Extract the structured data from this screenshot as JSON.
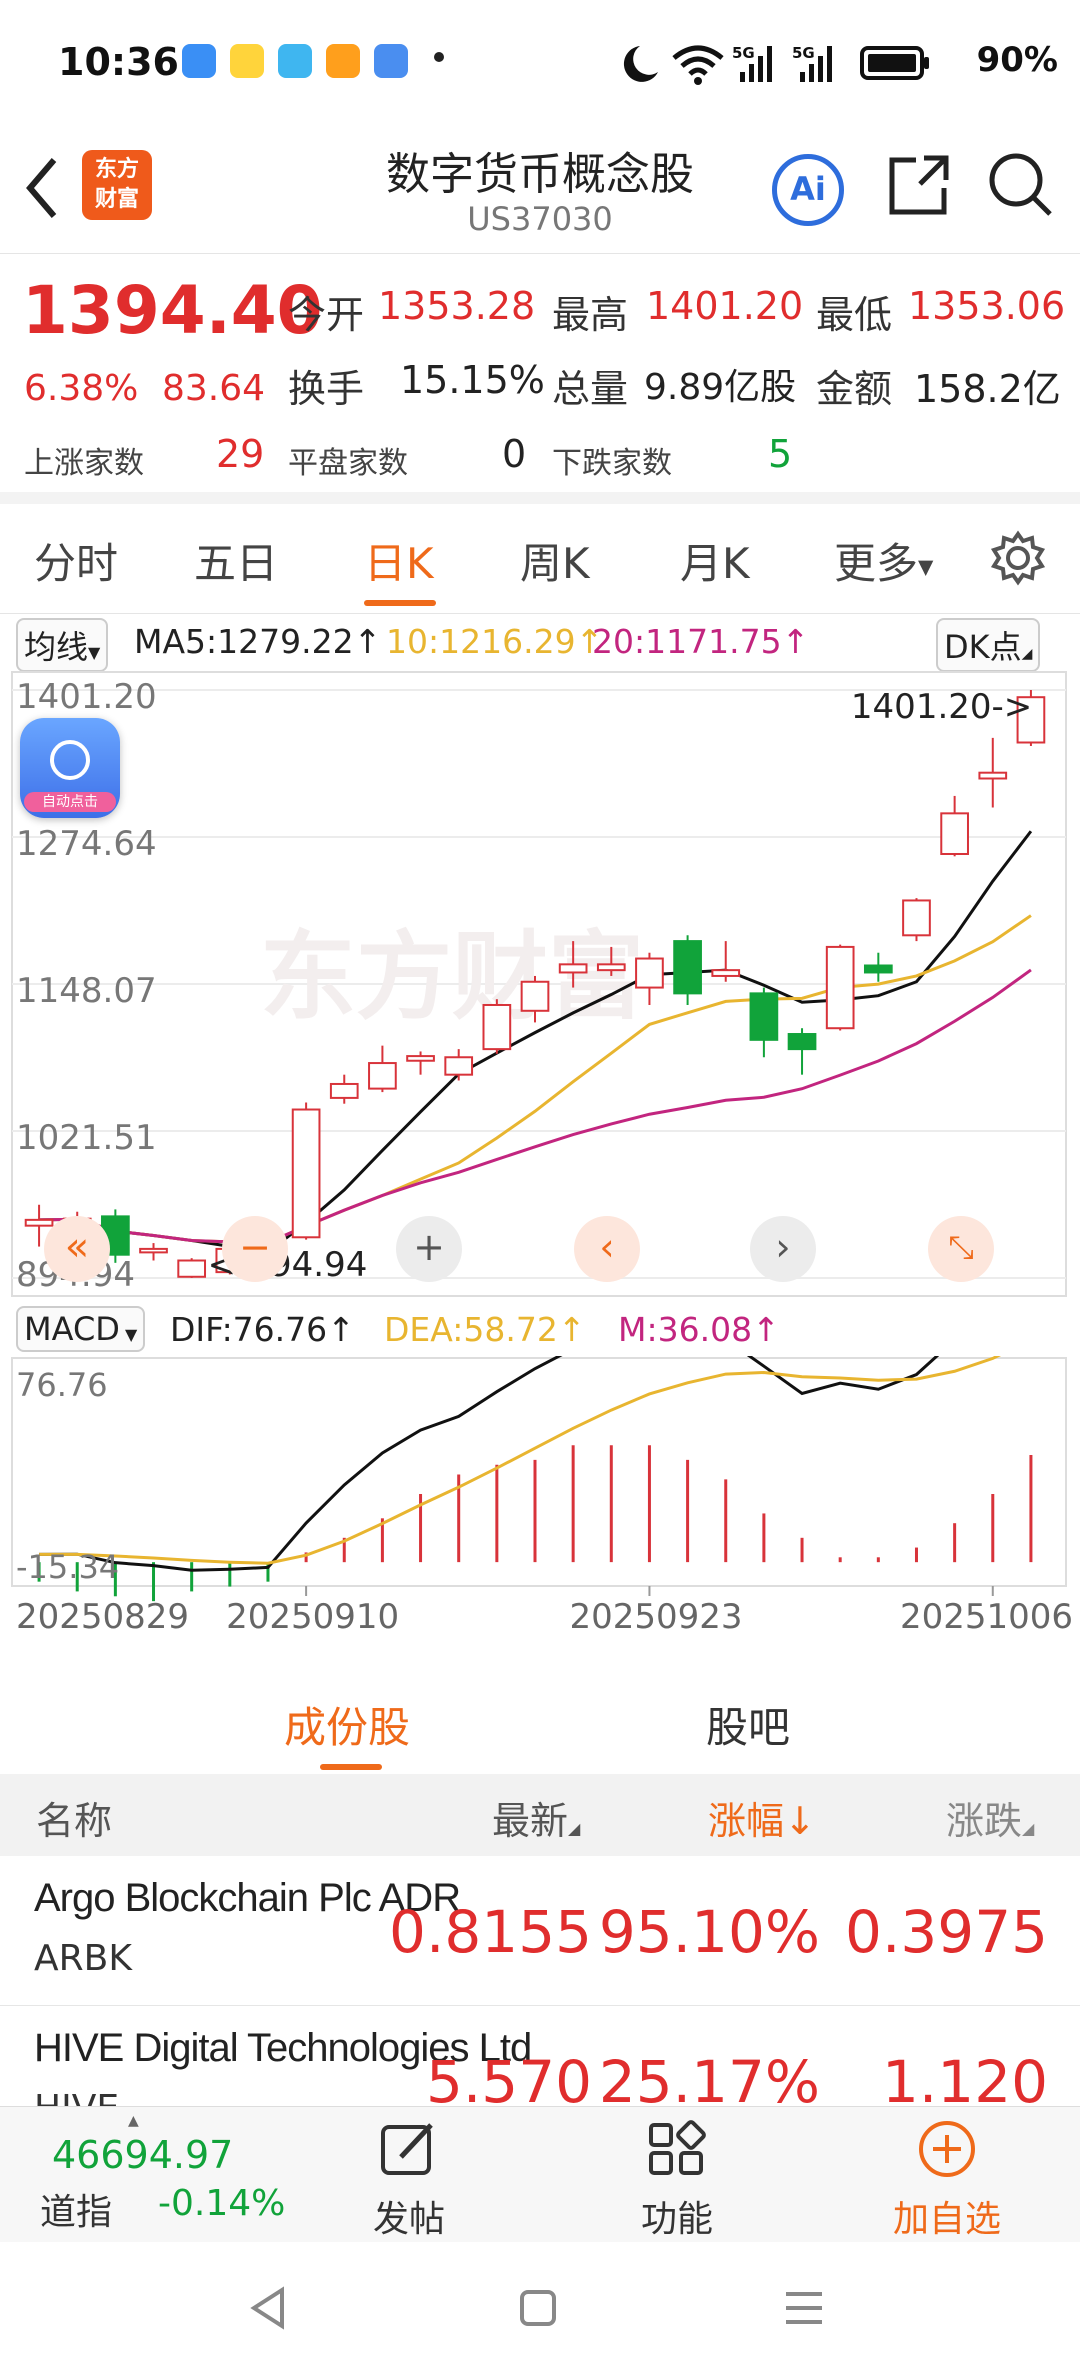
{
  "status_bar": {
    "time": "10:36",
    "battery": "90%",
    "icons": [
      "moon-icon",
      "wifi-icon",
      "5g-signal-icon",
      "5g-signal-icon",
      "battery-icon"
    ]
  },
  "header": {
    "title": "数字货币概念股",
    "code": "US37030",
    "logo_text_1": "东方",
    "logo_text_2": "财富",
    "ai_label": "Ai"
  },
  "quote": {
    "price": "1394.40",
    "change_pct": "6.38%",
    "change": "83.64",
    "open_label": "今开",
    "open": "1353.28",
    "high_label": "最高",
    "high": "1401.20",
    "low_label": "最低",
    "low": "1353.06",
    "turnover_label": "换手",
    "turnover": "15.15%",
    "volume_label": "总量",
    "volume": "9.89亿股",
    "amount_label": "金额",
    "amount": "158.2亿",
    "up_label": "上涨家数",
    "up": "29",
    "flat_label": "平盘家数",
    "flat": "0",
    "down_label": "下跌家数",
    "down": "5"
  },
  "tabs": [
    "分时",
    "五日",
    "日K",
    "周K",
    "月K",
    "更多"
  ],
  "active_tab": "日K",
  "ma": {
    "selector": "均线",
    "ma5": "MA5:1279.22↑",
    "ma10": "10:1216.29↑",
    "ma20": "20:1171.75↑",
    "dk": "DK点"
  },
  "kline": {
    "y_labels": [
      "1401.20",
      "1274.64",
      "1148.07",
      "1021.51",
      "894.94"
    ],
    "max_annot": "1401.20->",
    "min_annot": "<-894.94",
    "float_badge": "自动点击"
  },
  "macd": {
    "selector": "MACD",
    "dif": "DIF:76.76↑",
    "dea": "DEA:58.72↑",
    "m": "M:36.08↑",
    "y_top": "76.76",
    "y_bottom": "-15.34",
    "dates": [
      "20250829",
      "20250910",
      "20250923",
      "20251006"
    ]
  },
  "chart_data": {
    "type": "candlestick",
    "ylim": [
      894.94,
      1401.2
    ],
    "candles": [
      {
        "o": 940,
        "c": 945,
        "h": 958,
        "l": 922
      },
      {
        "o": 942,
        "c": 946,
        "h": 952,
        "l": 930
      },
      {
        "o": 948,
        "c": 915,
        "h": 954,
        "l": 908
      },
      {
        "o": 917,
        "c": 920,
        "h": 925,
        "l": 910
      },
      {
        "o": 896,
        "c": 910,
        "h": 912,
        "l": 895
      },
      {
        "o": 900,
        "c": 920,
        "h": 926,
        "l": 898
      },
      {
        "o": 910,
        "c": 922,
        "h": 930,
        "l": 905
      },
      {
        "o": 930,
        "c": 1040,
        "h": 1046,
        "l": 928
      },
      {
        "o": 1050,
        "c": 1062,
        "h": 1070,
        "l": 1045
      },
      {
        "o": 1058,
        "c": 1080,
        "h": 1095,
        "l": 1055
      },
      {
        "o": 1082,
        "c": 1086,
        "h": 1090,
        "l": 1070
      },
      {
        "o": 1070,
        "c": 1085,
        "h": 1092,
        "l": 1065
      },
      {
        "o": 1092,
        "c": 1130,
        "h": 1135,
        "l": 1088
      },
      {
        "o": 1125,
        "c": 1150,
        "h": 1155,
        "l": 1115
      },
      {
        "o": 1158,
        "c": 1165,
        "h": 1185,
        "l": 1145
      },
      {
        "o": 1160,
        "c": 1165,
        "h": 1180,
        "l": 1155
      },
      {
        "o": 1145,
        "c": 1170,
        "h": 1175,
        "l": 1130
      },
      {
        "o": 1185,
        "c": 1140,
        "h": 1190,
        "l": 1130
      },
      {
        "o": 1155,
        "c": 1160,
        "h": 1185,
        "l": 1150
      },
      {
        "o": 1140,
        "c": 1100,
        "h": 1145,
        "l": 1085
      },
      {
        "o": 1105,
        "c": 1092,
        "h": 1110,
        "l": 1070
      },
      {
        "o": 1110,
        "c": 1180,
        "h": 1182,
        "l": 1108
      },
      {
        "o": 1164,
        "c": 1158,
        "h": 1175,
        "l": 1150
      },
      {
        "o": 1190,
        "c": 1220,
        "h": 1222,
        "l": 1185
      },
      {
        "o": 1260,
        "c": 1295,
        "h": 1310,
        "l": 1258
      },
      {
        "o": 1325,
        "c": 1330,
        "h": 1360,
        "l": 1300
      },
      {
        "o": 1356,
        "c": 1395,
        "h": 1401.2,
        "l": 1353
      }
    ],
    "macd": {
      "ylim": [
        -15.34,
        76.76
      ],
      "hist": [
        -4,
        -6,
        -7,
        -8,
        -6,
        -5,
        -4,
        2,
        5,
        9,
        14,
        18,
        20,
        21,
        24,
        24,
        24,
        21,
        17,
        10,
        5,
        1,
        1,
        3,
        8,
        14,
        22
      ]
    }
  },
  "list": {
    "tab_active": "成份股",
    "tab_other": "股吧",
    "col_name": "名称",
    "col_latest": "最新",
    "col_change_pct": "涨幅↓",
    "col_change": "涨跌",
    "rows": [
      {
        "name": "Argo Blockchain Plc ADR",
        "ticker": "ARBK",
        "latest": "0.8155",
        "pct": "95.10%",
        "chg": "0.3975"
      },
      {
        "name": "HIVE Digital Technologies Ltd",
        "ticker": "HIVE",
        "latest": "5.570",
        "pct": "25.17%",
        "chg": "1.120"
      }
    ]
  },
  "bottom_bar": {
    "index_value": "46694.97",
    "index_name": "道指",
    "index_change": "-0.14%",
    "post": "发帖",
    "func": "功能",
    "add": "加自选"
  }
}
